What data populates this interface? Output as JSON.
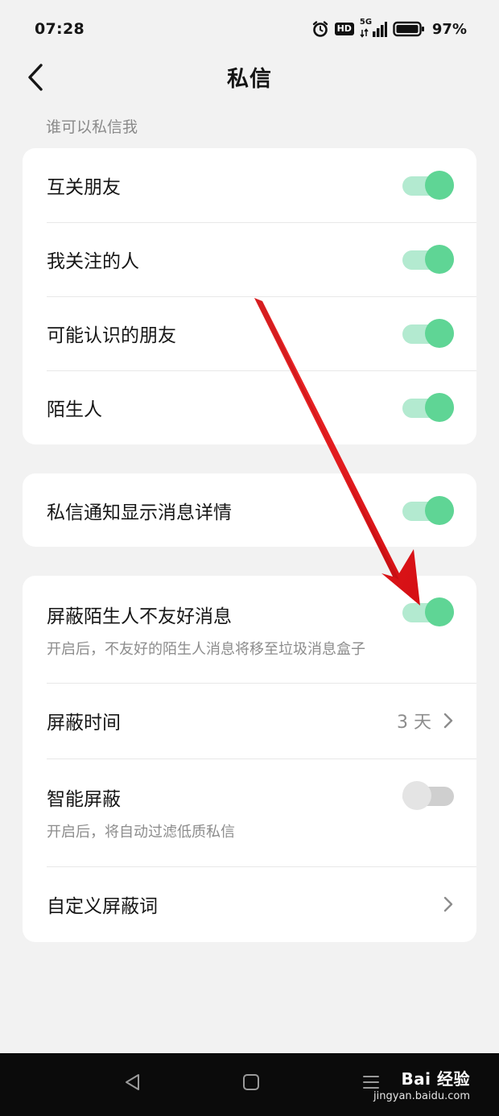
{
  "status_bar": {
    "time": "07:28",
    "hd": "HD",
    "network": "5G",
    "battery": "97%"
  },
  "header": {
    "title": "私信"
  },
  "section_label": "谁可以私信我",
  "who_can_message": [
    {
      "label": "互关朋友",
      "enabled": true
    },
    {
      "label": "我关注的人",
      "enabled": true
    },
    {
      "label": "可能认识的朋友",
      "enabled": true
    },
    {
      "label": "陌生人",
      "enabled": true
    }
  ],
  "notification": {
    "label": "私信通知显示消息详情",
    "enabled": true
  },
  "block_strangers": {
    "label": "屏蔽陌生人不友好消息",
    "sub": "开启后，不友好的陌生人消息将移至垃圾消息盒子",
    "enabled": true
  },
  "block_time": {
    "label": "屏蔽时间",
    "value": "3 天"
  },
  "smart_block": {
    "label": "智能屏蔽",
    "sub": "开启后，将自动过滤低质私信",
    "enabled": false
  },
  "custom_words": {
    "label": "自定义屏蔽词"
  },
  "watermark": {
    "brand": "Bai 经验",
    "url": "jingyan.baidu.com"
  },
  "colors": {
    "toggle_on_knob": "#5fd595",
    "toggle_on_track": "#b3ead0",
    "toggle_off_knob": "#e4e4e4",
    "toggle_off_track": "#cfcfcf",
    "annotation_arrow": "#e8141a"
  }
}
